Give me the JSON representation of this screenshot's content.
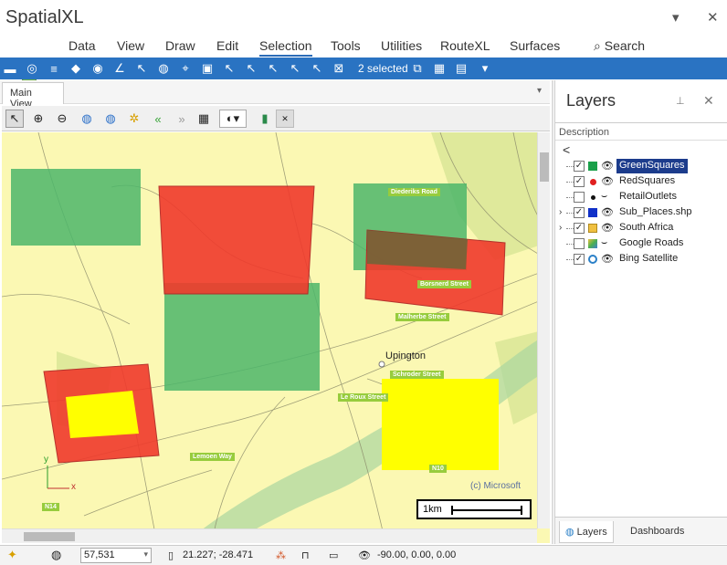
{
  "app": {
    "title": "SpatialXL",
    "minimize_glyph": "▾",
    "close_glyph": "✕"
  },
  "menu": [
    "Data",
    "View",
    "Draw",
    "Edit",
    "Selection",
    "Tools",
    "Utilities",
    "RouteXL",
    "Surfaces"
  ],
  "menu_active": "Selection",
  "search_label": "Search",
  "toolbar": {
    "selected_text": "2 selected"
  },
  "document_tab": "Main View",
  "map": {
    "place_label": "Upington",
    "road_labels": [
      "Diederiks Road",
      "Borsnerd Street",
      "Malherbe Street",
      "Schroder Street",
      "Le Roux Street",
      "Lemoen Way",
      "N10",
      "N14"
    ],
    "copyright": "(c) Microsoft",
    "scale_label": "1km",
    "axis_y": "y",
    "axis_x": "x",
    "polygon_colors": {
      "green": "#4cb66a",
      "red": "#f03a2c",
      "yellow": "#ffff00"
    }
  },
  "layers_panel": {
    "title": "Layers",
    "column_header": "Description",
    "back_glyph": "<",
    "layers": [
      {
        "name": "GreenSquares",
        "checked": true,
        "visible": true,
        "symbol": "green-square",
        "selected": true
      },
      {
        "name": "RedSquares",
        "checked": true,
        "visible": true,
        "symbol": "red-dot"
      },
      {
        "name": "RetailOutlets",
        "checked": false,
        "visible": false,
        "symbol": "black-dot"
      },
      {
        "name": "Sub_Places.shp",
        "checked": true,
        "visible": true,
        "symbol": "blue-polygon",
        "expander": true
      },
      {
        "name": "South Africa",
        "checked": true,
        "visible": true,
        "symbol": "folder",
        "expander": true
      },
      {
        "name": "Google Roads",
        "checked": false,
        "visible": false,
        "symbol": "map-tile"
      },
      {
        "name": "Bing Satellite",
        "checked": true,
        "visible": true,
        "symbol": "satellite"
      }
    ],
    "tabs": [
      "Layers",
      "Dashboards"
    ],
    "active_tab": "Layers"
  },
  "status": {
    "zoom": "57,531",
    "coords": "21.227; -28.471",
    "rotation": "-90.00, 0.00, 0.00"
  }
}
